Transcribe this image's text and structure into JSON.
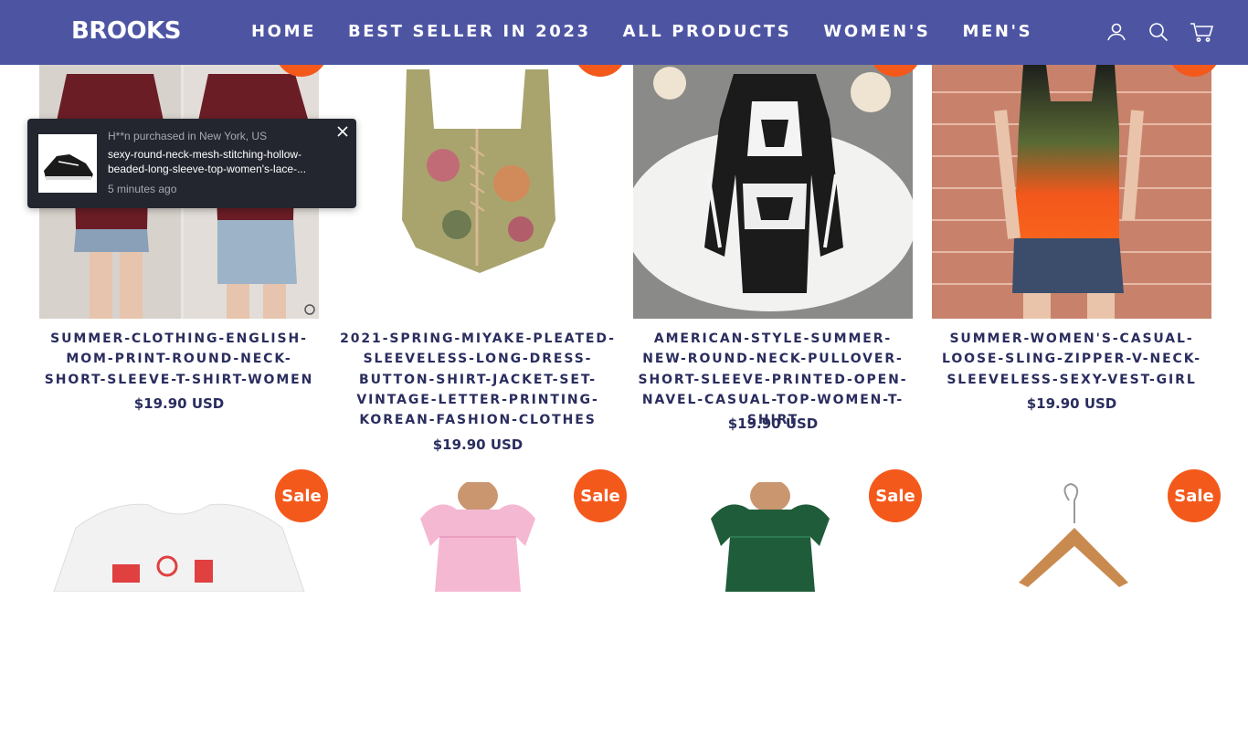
{
  "header": {
    "logo": "BROOKS",
    "nav": [
      "HOME",
      "BEST SELLER IN 2023",
      "ALL PRODUCTS",
      "WOMEN'S",
      "MEN'S"
    ],
    "icons": [
      "account-icon",
      "search-icon",
      "cart-icon"
    ]
  },
  "popup": {
    "who": "H**n purchased in New York, US",
    "product": "sexy-round-neck-mesh-stitching-hollow-beaded-long-sleeve-top-women's-lace-...",
    "time": "5 minutes ago"
  },
  "products": [
    {
      "title": "SUMMER-CLOTHING-ENGLISH-MOM-PRINT-ROUND-NECK-SHORT-SLEEVE-T-SHIRT-WOMEN",
      "price": "$19.90 USD"
    },
    {
      "title": "2021-SPRING-MIYAKE-PLEATED-SLEEVELESS-LONG-DRESS-BUTTON-SHIRT-JACKET-SET-VINTAGE-LETTER-PRINTING-KOREAN-FASHION-CLOTHES",
      "price": "$19.90 USD"
    },
    {
      "title": "AMERICAN-STYLE-SUMMER-NEW-ROUND-NECK-PULLOVER-SHORT-SLEEVE-PRINTED-OPEN-NAVEL-CASUAL-TOP-WOMEN-T-SHIRT",
      "price": "$19.90 USD"
    },
    {
      "title": "SUMMER-WOMEN'S-CASUAL-LOOSE-SLING-ZIPPER-V-NECK-SLEEVELESS-SEXY-VEST-GIRL",
      "price": "$19.90 USD"
    }
  ],
  "sale_label": "Sale",
  "colors": {
    "header": "#4d55a3",
    "sale": "#f4591c",
    "title": "#2a2d5e",
    "popup": "#23262f"
  }
}
